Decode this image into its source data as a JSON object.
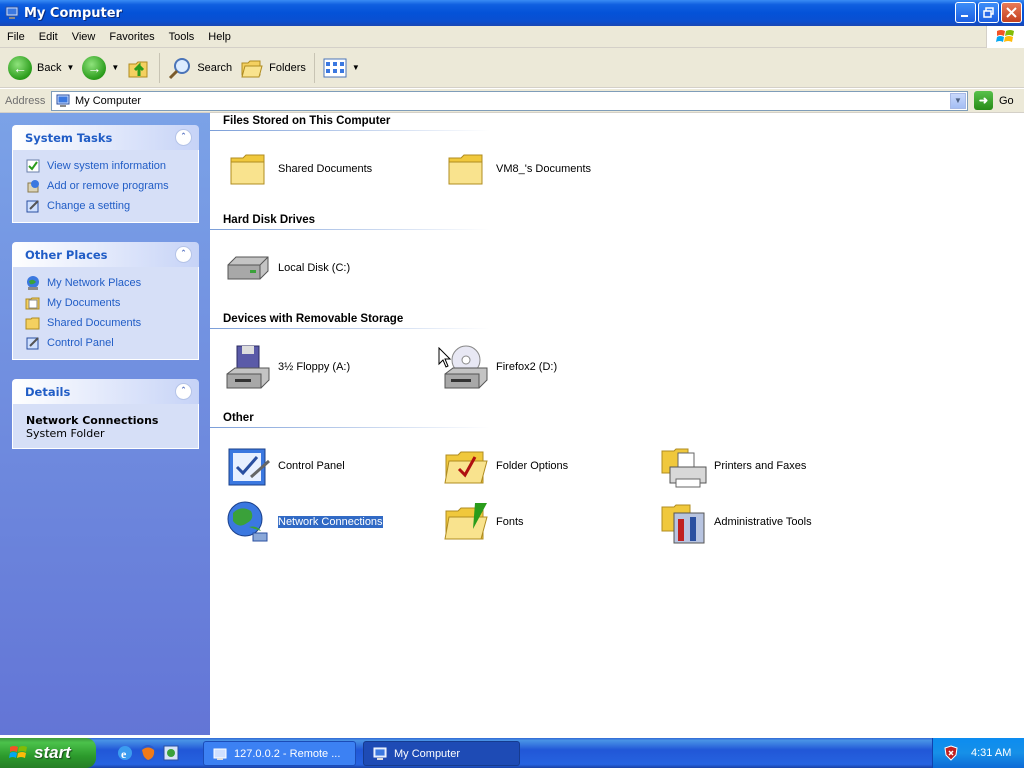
{
  "window": {
    "title": "My Computer"
  },
  "menu": [
    "File",
    "Edit",
    "View",
    "Favorites",
    "Tools",
    "Help"
  ],
  "toolbar": {
    "back": "Back",
    "search": "Search",
    "folders": "Folders"
  },
  "address": {
    "label": "Address",
    "value": "My Computer",
    "go": "Go"
  },
  "left": {
    "system_tasks": {
      "title": "System Tasks",
      "items": [
        "View system information",
        "Add or remove programs",
        "Change a setting"
      ]
    },
    "other_places": {
      "title": "Other Places",
      "items": [
        "My Network Places",
        "My Documents",
        "Shared Documents",
        "Control Panel"
      ]
    },
    "details": {
      "title": "Details",
      "name": "Network Connections",
      "type": "System Folder"
    }
  },
  "groups": {
    "files": {
      "title": "Files Stored on This Computer",
      "items": [
        "Shared Documents",
        "VM8_'s Documents"
      ]
    },
    "hdd": {
      "title": "Hard Disk Drives",
      "items": [
        "Local Disk (C:)"
      ]
    },
    "removable": {
      "title": "Devices with Removable Storage",
      "items": [
        "3½ Floppy (A:)",
        "Firefox2 (D:)"
      ]
    },
    "other": {
      "title": "Other",
      "items": [
        "Control Panel",
        "Folder Options",
        "Printers and Faxes",
        "Network Connections",
        "Fonts",
        "Administrative Tools"
      ]
    }
  },
  "taskbar": {
    "start": "start",
    "tasks": [
      "127.0.0.2 - Remote ...",
      "My Computer"
    ],
    "clock": "4:31 AM"
  },
  "colors": {
    "title_bar": "#0452d8",
    "task_link": "#215dc6",
    "selection": "#316ac5",
    "start_green": "#2c9a2c"
  }
}
